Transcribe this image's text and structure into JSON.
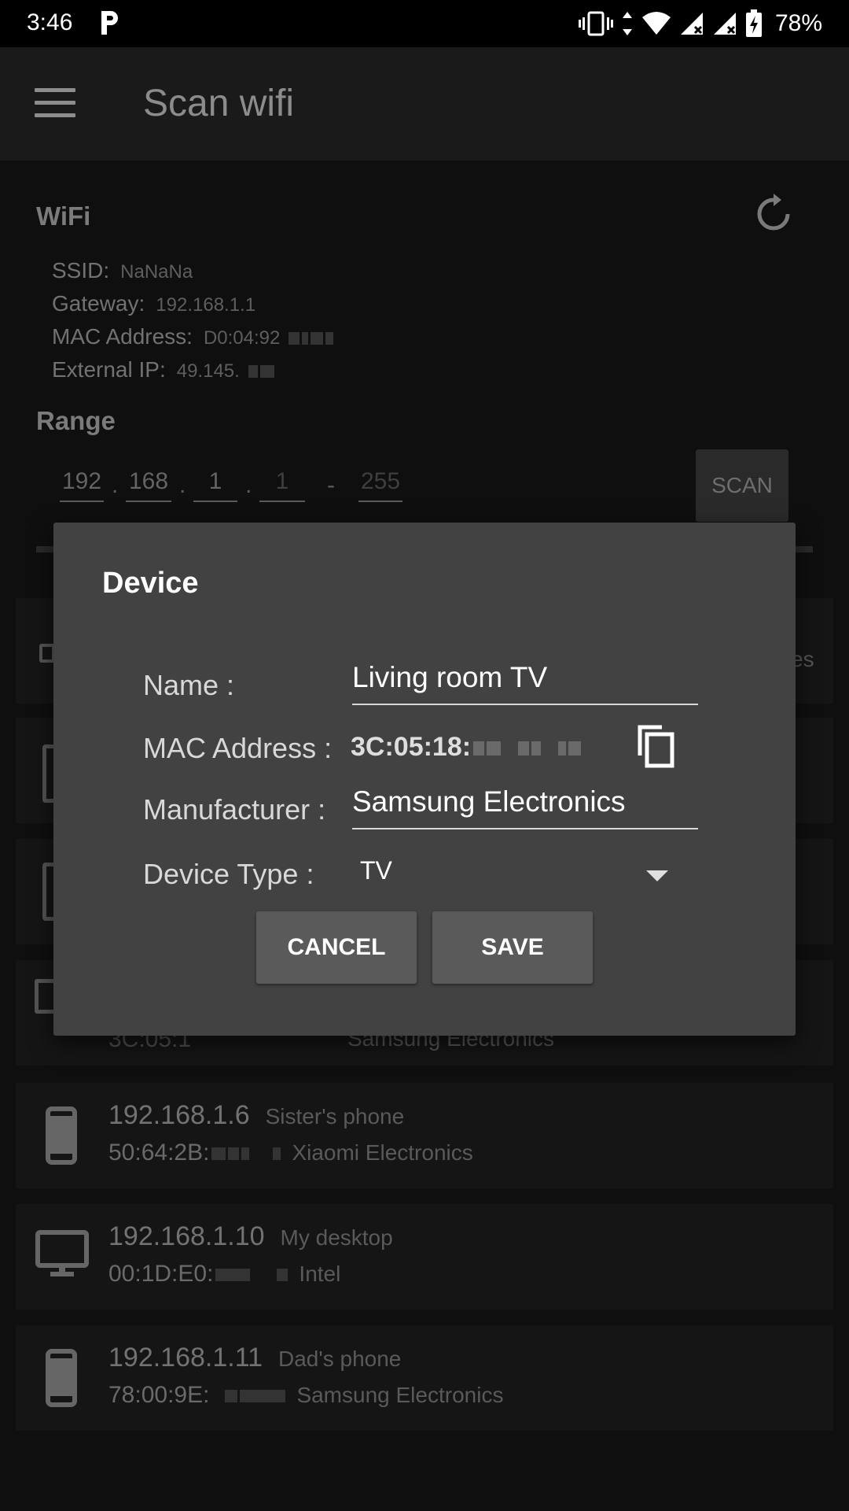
{
  "status_bar": {
    "time": "3:46",
    "battery": "78%"
  },
  "app_bar": {
    "title": "Scan wifi"
  },
  "wifi": {
    "section_title": "WiFi",
    "ssid_label": "SSID:",
    "ssid": "NaNaNa",
    "gateway_label": "Gateway:",
    "gateway": "192.168.1.1",
    "mac_label": "MAC Address:",
    "mac": "D0:04:92",
    "external_ip_label": "External IP:",
    "external_ip": "49.145."
  },
  "range": {
    "section_title": "Range",
    "octet1": "192",
    "octet2": "168",
    "octet3": "1",
    "start": "1",
    "end": "255",
    "dot": ".",
    "dash": "-",
    "scan_label": "SCAN"
  },
  "devices": [
    {
      "ip": "192.168.1.6",
      "name": "Sister's phone",
      "mac": "50:64:2B:",
      "manufacturer": "Xiaomi Electronics"
    },
    {
      "ip": "192.168.1.10",
      "name": "My desktop",
      "mac": "00:1D:E0:",
      "manufacturer": "Intel"
    },
    {
      "ip": "192.168.1.11",
      "name": "Dad's phone",
      "mac": "78:00:9E:",
      "manufacturer": "Samsung Electronics"
    }
  ],
  "peek": {
    "card4_text": "Samsung Electronics",
    "card1_suffix": "es",
    "card4_mac": "3C:05:1"
  },
  "dialog": {
    "title": "Device",
    "name_label": "Name :",
    "name_value": "Living room TV",
    "mac_label": "MAC Address :",
    "mac_value": "3C:05:18:",
    "manufacturer_label": "Manufacturer :",
    "manufacturer_value": "Samsung Electronics",
    "device_type_label": "Device Type :",
    "device_type_value": "TV",
    "cancel_label": "CANCEL",
    "save_label": "SAVE"
  }
}
